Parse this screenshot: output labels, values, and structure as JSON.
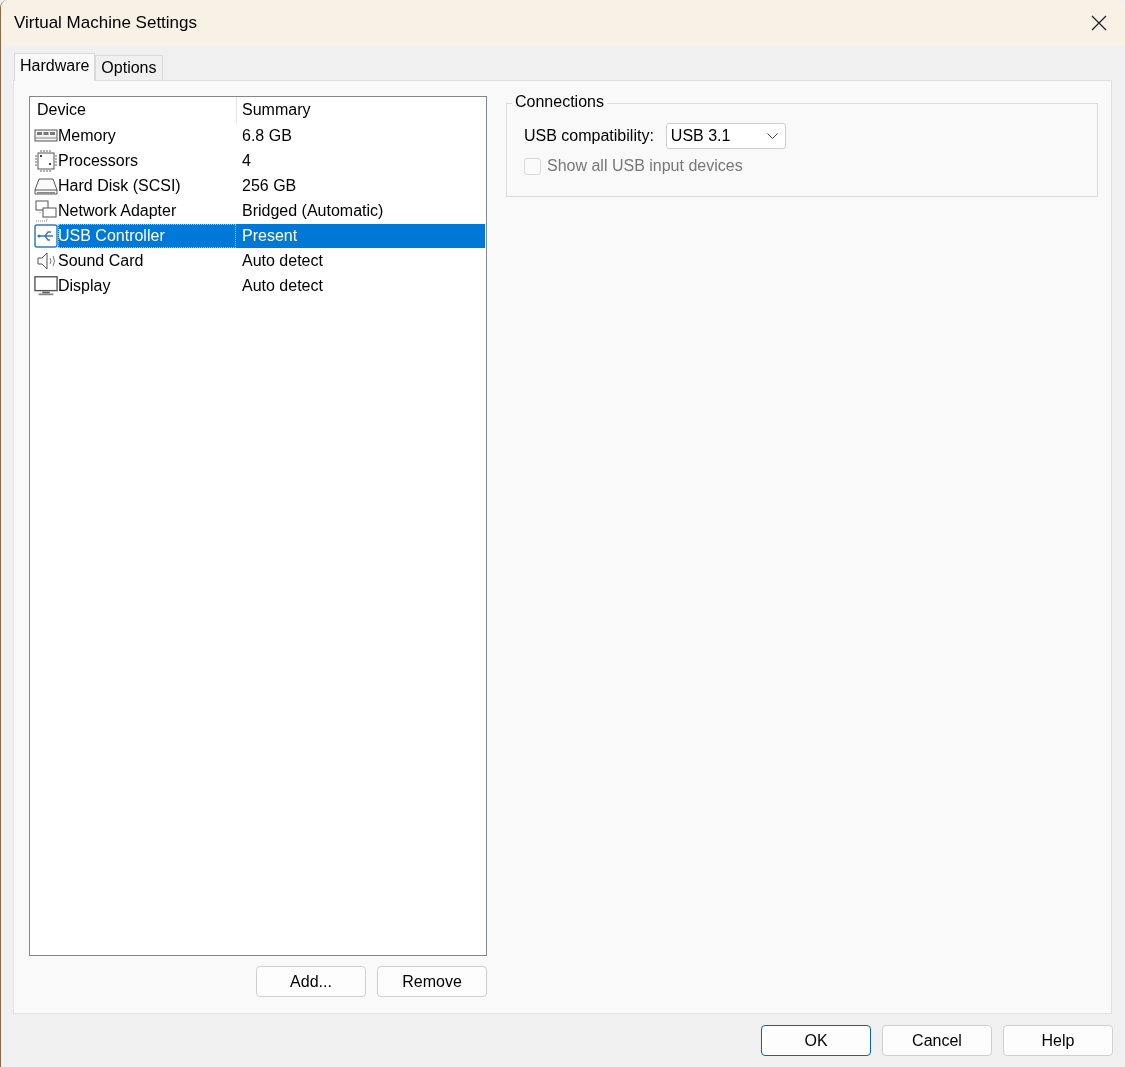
{
  "window": {
    "title": "Virtual Machine Settings"
  },
  "tabs": [
    {
      "label": "Hardware",
      "selected": true
    },
    {
      "label": "Options",
      "selected": false
    }
  ],
  "device_list": {
    "columns": [
      "Device",
      "Summary"
    ],
    "rows": [
      {
        "kind": "memory",
        "device": "Memory",
        "summary": "6.8 GB",
        "selected": false
      },
      {
        "kind": "processor",
        "device": "Processors",
        "summary": "4",
        "selected": false
      },
      {
        "kind": "disk",
        "device": "Hard Disk (SCSI)",
        "summary": "256 GB",
        "selected": false
      },
      {
        "kind": "network",
        "device": "Network Adapter",
        "summary": "Bridged (Automatic)",
        "selected": false
      },
      {
        "kind": "usb",
        "device": "USB Controller",
        "summary": "Present",
        "selected": true
      },
      {
        "kind": "sound",
        "device": "Sound Card",
        "summary": "Auto detect",
        "selected": false
      },
      {
        "kind": "display",
        "device": "Display",
        "summary": "Auto detect",
        "selected": false
      }
    ]
  },
  "list_buttons": [
    "Add...",
    "Remove"
  ],
  "connections": {
    "title": "Connections",
    "usb_compatibility": {
      "label": "USB compatibility:",
      "value": "USB 3.1"
    },
    "show_all_usb": {
      "label": "Show all USB input devices",
      "checked": false,
      "disabled": true
    }
  },
  "buttons": [
    {
      "label": "OK",
      "default": true
    },
    {
      "label": "Cancel",
      "default": false
    },
    {
      "label": "Help",
      "default": false
    }
  ]
}
